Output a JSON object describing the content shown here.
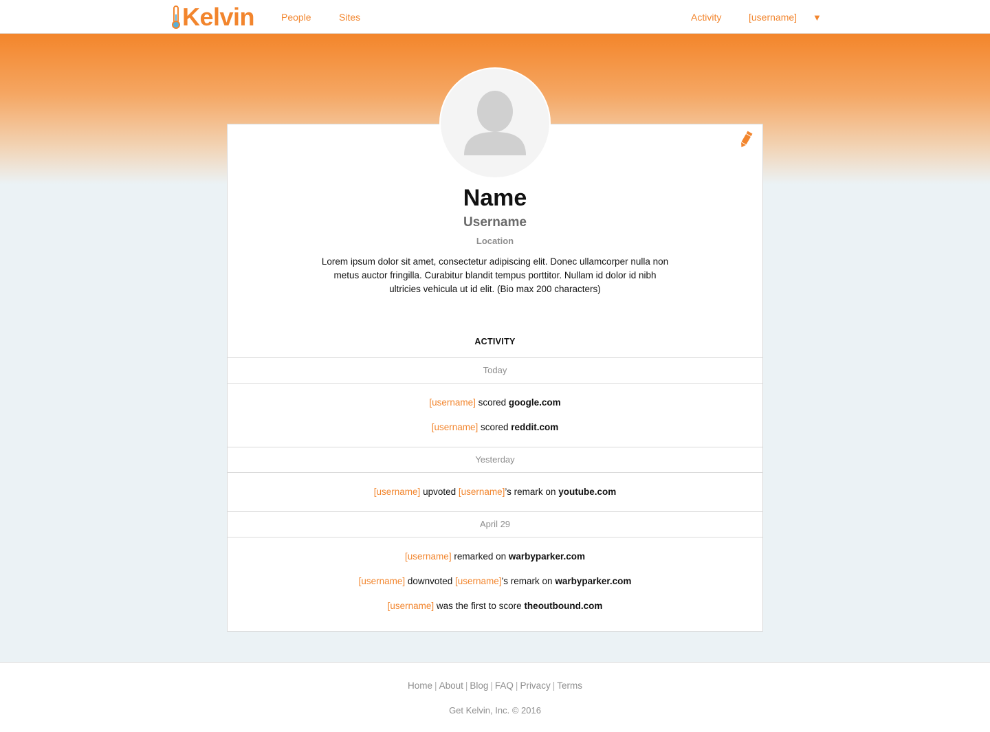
{
  "brand": {
    "name": "Kelvin",
    "accent": "#f2852d"
  },
  "nav": {
    "people": "People",
    "sites": "Sites",
    "activity": "Activity",
    "user_menu": "[username]",
    "caret": "▼"
  },
  "profile": {
    "avatar_icon": "user-silhouette-icon",
    "edit_icon": "pencil-icon",
    "name": "Name",
    "username": "Username",
    "location": "Location",
    "bio": "Lorem ipsum dolor sit amet, consectetur adipiscing elit. Donec ullamcorper nulla non metus auctor fringilla. Curabitur blandit tempus porttitor. Nullam id dolor id nibh ultricies vehicula ut id elit. (Bio max 200 characters)"
  },
  "activity": {
    "heading": "ACTIVITY",
    "groups": [
      {
        "date": "Today",
        "items": [
          {
            "user": "[username]",
            "action": "scored",
            "site": "google.com"
          },
          {
            "user": "[username]",
            "action": "scored",
            "site": "reddit.com"
          }
        ]
      },
      {
        "date": "Yesterday",
        "items": [
          {
            "user": "[username]",
            "action": "upvoted",
            "target_user": "[username]",
            "suffix": "’s remark on",
            "site": "youtube.com"
          }
        ]
      },
      {
        "date": "April 29",
        "items": [
          {
            "user": "[username]",
            "action": "remarked on",
            "site": "warbyparker.com"
          },
          {
            "user": "[username]",
            "action": "downvoted",
            "target_user": "[username]",
            "suffix": "’s remark on",
            "site": "warbyparker.com"
          },
          {
            "user": "[username]",
            "action": "was the first to score",
            "site": "theoutbound.com"
          }
        ]
      }
    ]
  },
  "footer": {
    "links": [
      "Home",
      "About",
      "Blog",
      "FAQ",
      "Privacy",
      "Terms"
    ],
    "separator": "|",
    "copyright": "Get Kelvin, Inc. © 2016"
  }
}
